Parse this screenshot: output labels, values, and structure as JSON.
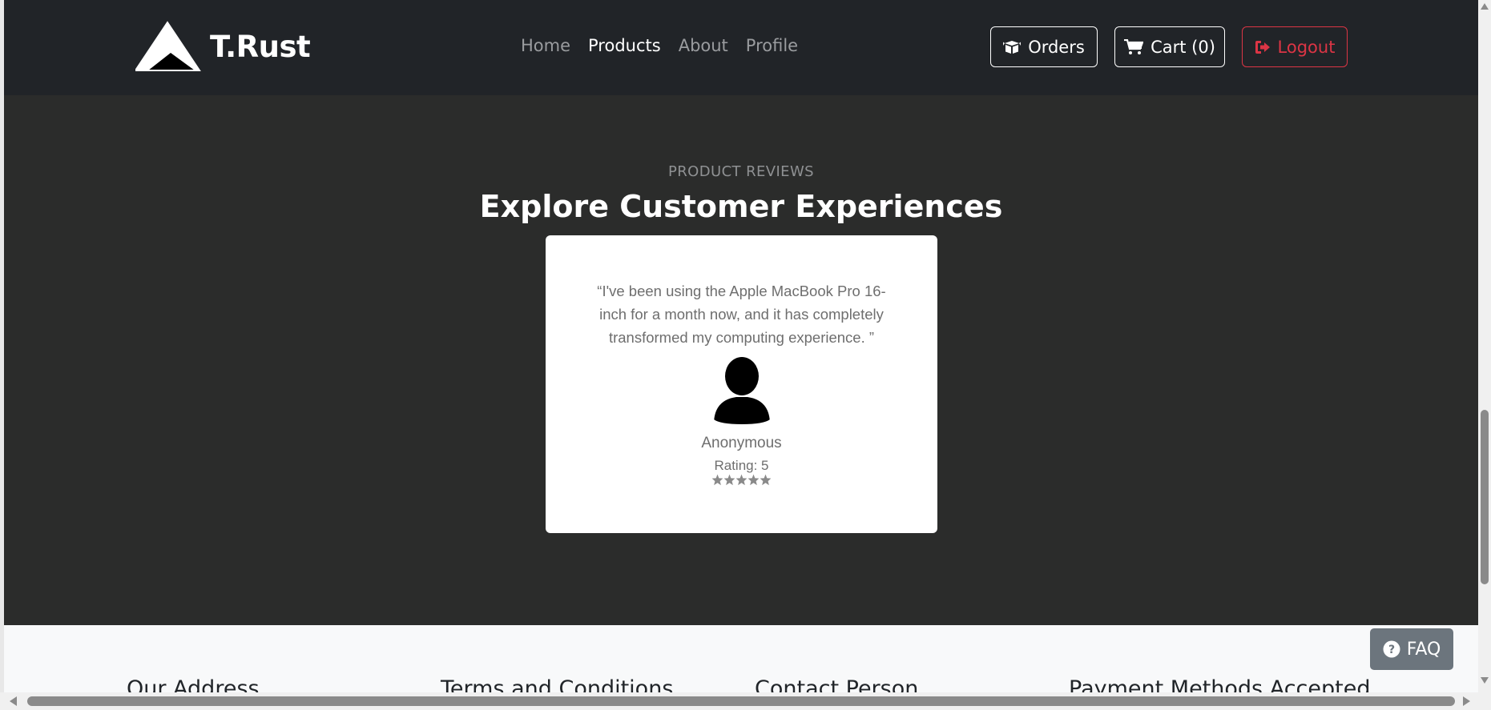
{
  "brand": {
    "name": "T.Rust",
    "logo_icon": "mountain-logo"
  },
  "nav": {
    "links": [
      {
        "label": "Home",
        "active": false
      },
      {
        "label": "Products",
        "active": true
      },
      {
        "label": "About",
        "active": false
      },
      {
        "label": "Profile",
        "active": false
      }
    ],
    "orders_label": "Orders",
    "cart_label": "Cart (0)",
    "logout_label": "Logout"
  },
  "reviews": {
    "kicker": "PRODUCT REVIEWS",
    "title": "Explore Customer Experiences",
    "items": [
      {
        "text": "“I've been using the Apple MacBook Pro 16-inch for a month now, and it has completely transformed my computing experience. ”",
        "reviewer": "Anonymous",
        "rating_label": "Rating: 5",
        "rating": 5,
        "max_rating": 5
      }
    ]
  },
  "footer": {
    "columns": [
      "Our Address",
      "Terms and Conditions",
      "Contact Person",
      "Payment Methods Accepted"
    ]
  },
  "faq_label": "FAQ",
  "colors": {
    "navbar": "#212428",
    "section_bg": "#2b2c2b",
    "logout": "#dc3545",
    "faq": "#6c757d",
    "star": "#8a8a8a"
  }
}
